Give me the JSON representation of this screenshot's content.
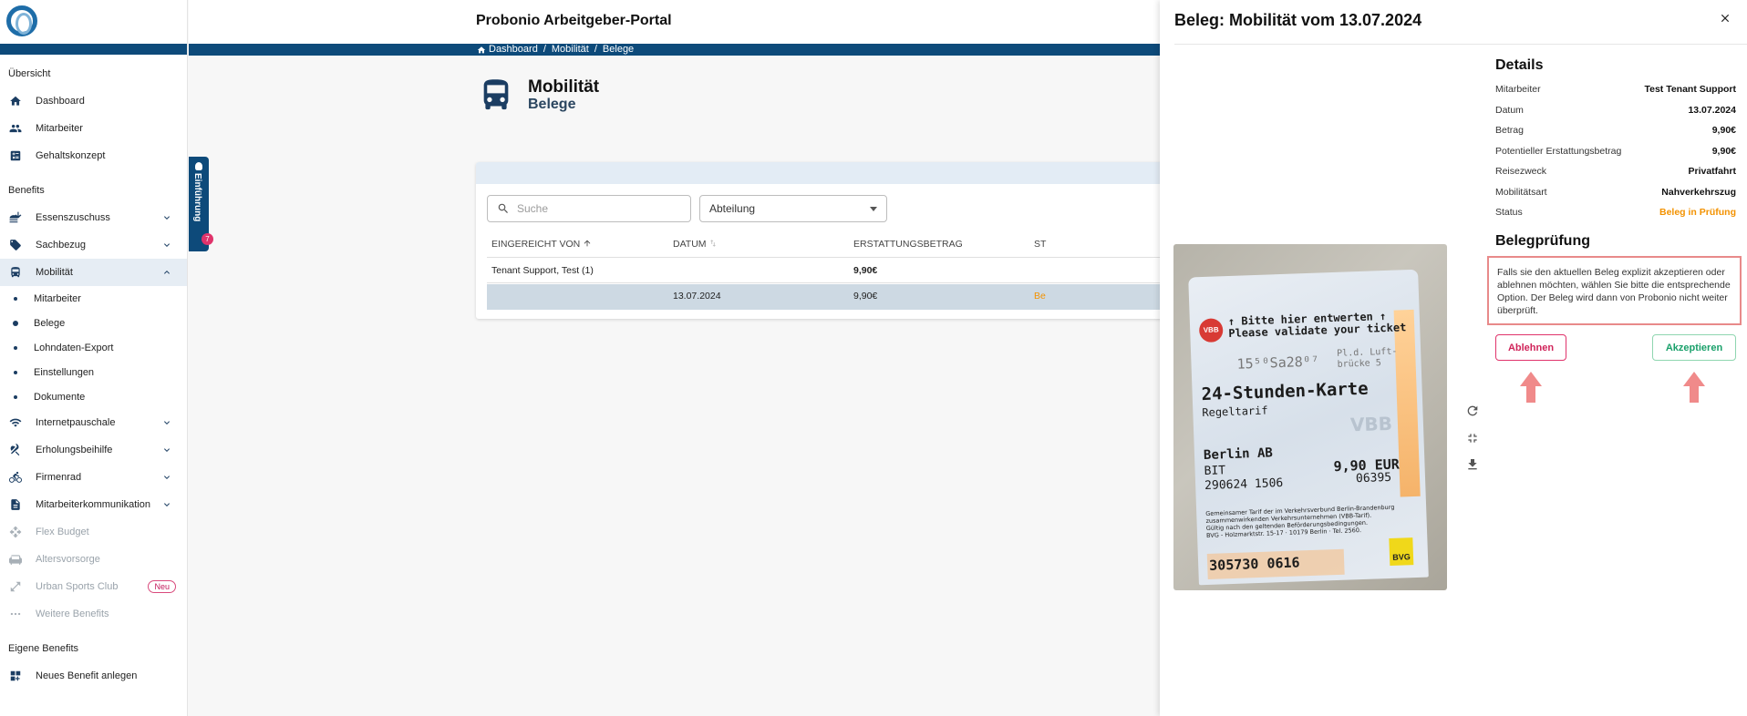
{
  "sidebar": {
    "section_overview": "Übersicht",
    "overview_items": [
      {
        "label": "Dashboard",
        "icon": "home-icon"
      },
      {
        "label": "Mitarbeiter",
        "icon": "people-icon"
      },
      {
        "label": "Gehaltskonzept",
        "icon": "calculator-icon"
      }
    ],
    "section_benefits": "Benefits",
    "benefits": [
      {
        "label": "Essenszuschuss",
        "icon": "food-icon"
      },
      {
        "label": "Sachbezug",
        "icon": "tag-icon"
      },
      {
        "label": "Mobilität",
        "icon": "bus-icon"
      }
    ],
    "mobility_sub": [
      "Mitarbeiter",
      "Belege",
      "Lohndaten-Export",
      "Einstellungen",
      "Dokumente"
    ],
    "benefits_more": [
      {
        "label": "Internetpauschale",
        "icon": "wifi-icon"
      },
      {
        "label": "Erholungsbeihilfe",
        "icon": "palm-icon"
      },
      {
        "label": "Firmenrad",
        "icon": "bike-icon"
      },
      {
        "label": "Mitarbeiterkommunikation",
        "icon": "document-icon"
      }
    ],
    "disabled_items": [
      {
        "label": "Flex Budget",
        "icon": "move-icon"
      },
      {
        "label": "Altersvorsorge",
        "icon": "sofa-icon"
      },
      {
        "label": "Urban Sports Club",
        "icon": "expand-icon",
        "badge": "Neu"
      },
      {
        "label": "Weitere Benefits",
        "icon": "dots-icon"
      }
    ],
    "section_own": "Eigene Benefits",
    "own_item": {
      "label": "Neues Benefit anlegen",
      "icon": "grid-plus-icon"
    }
  },
  "intro_tab": {
    "label": "Einführung",
    "count": "7"
  },
  "header": {
    "title": "Probonio Arbeitgeber-Portal"
  },
  "breadcrumb": [
    "Dashboard",
    "/",
    "Mobilität",
    "/",
    "Belege"
  ],
  "page": {
    "title": "Mobilität",
    "subtitle": "Belege"
  },
  "filters": {
    "search_placeholder": "Suche",
    "department": "Abteilung"
  },
  "table": {
    "columns": [
      "EINGEREICHT VON",
      "DATUM",
      "ERSTATTUNGSBETRAG",
      "ST"
    ],
    "group_row": {
      "name": "Tenant Support, Test",
      "count": "(1)",
      "amount": "9,90€"
    },
    "rows": [
      {
        "date": "13.07.2024",
        "amount": "9,90€",
        "status_fragment": "Be"
      }
    ]
  },
  "drawer": {
    "title": "Beleg: Mobilität vom 13.07.2024",
    "details_title": "Details",
    "details": [
      {
        "label": "Mitarbeiter",
        "value": "Test Tenant Support"
      },
      {
        "label": "Datum",
        "value": "13.07.2024"
      },
      {
        "label": "Betrag",
        "value": "9,90€"
      },
      {
        "label": "Potentieller Erstattungsbetrag",
        "value": "9,90€"
      },
      {
        "label": "Reisezweck",
        "value": "Privatfahrt"
      },
      {
        "label": "Mobilitätsart",
        "value": "Nahverkehrszug"
      },
      {
        "label": "Status",
        "value": "Beleg in Prüfung"
      }
    ],
    "review_title": "Belegprüfung",
    "review_text": "Falls sie den aktuellen Beleg explizit akzeptieren oder ablehnen möchten, wählen Sie bitte die entsprechende Option. Der Beleg wird dann von Probonio nicht weiter überprüft.",
    "reject_label": "Ablehnen",
    "accept_label": "Akzeptieren"
  },
  "ticket": {
    "validate_line1": "↑ Bitte hier entwerten ↑",
    "validate_line2": "Please validate your ticket",
    "stamp": "15⁵⁰Sa28⁰⁷",
    "stamp_station": "Pl.d. Luft-\nbrücke 5",
    "title": "24-Stunden-Karte",
    "tarif": "Regeltarif",
    "city": "Berlin AB",
    "b1t": "BIT",
    "price": "9,90 EUR",
    "date_code": "290624 1506",
    "number": "06395",
    "fine_print": "Gemeinsamer Tarif der im Verkehrsverbund Berlin-Brandenburg\nzusammenwirkenden Verkehrsunternehmen (VBB-Tarif).\nGültig nach den geltenden Beförderungsbedingungen.\nBVG - Holzmarktstr. 15-17 · 10179 Berlin · Tel. 2560.",
    "serial": "305730 0616",
    "vbb": "VBB",
    "bvg": "BVG"
  },
  "colors": {
    "brand_dark": "#0d4a7a",
    "status_orange": "#f39200",
    "reject_pink": "#e0336b",
    "accept_green": "#19a06a"
  }
}
